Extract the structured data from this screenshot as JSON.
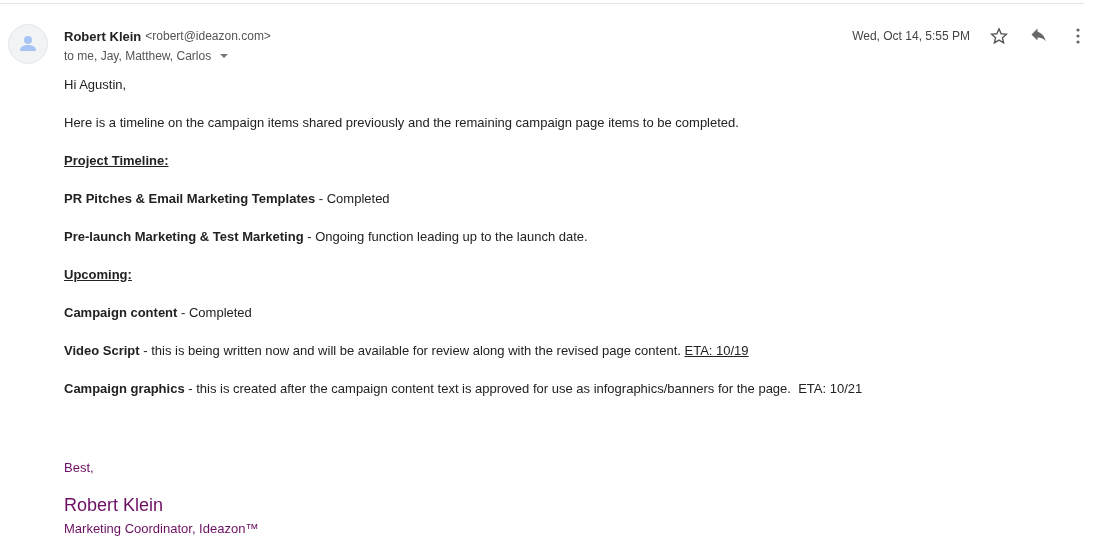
{
  "message": {
    "sender_name": "Robert Klein",
    "sender_email": "<robert@ideazon.com>",
    "recipients": "to me, Jay, Matthew, Carlos",
    "date": "Wed, Oct 14, 5:55 PM",
    "starred": false
  },
  "body": [
    {
      "kind": "text",
      "text": "Hi Agustin,"
    },
    {
      "kind": "text",
      "text": "Here is a timeline on the campaign items shared previously and the remaining campaign page items to be completed."
    },
    {
      "kind": "heading",
      "text": "Project Timeline:"
    },
    {
      "kind": "text",
      "text": "**PR Pitches & Email Marketing Templates** - Completed"
    },
    {
      "kind": "text",
      "text": "**Pre-launch Marketing & Test Marketing** - Ongoing function leading up to the launch date."
    },
    {
      "kind": "heading",
      "text": "Upcoming:"
    },
    {
      "kind": "text",
      "text": "**Campaign content** - Completed"
    },
    {
      "kind": "text",
      "text": "**Video Script** - this is being written now and will be available for review along with the revised page content.",
      "link": "ETA: 10/19"
    },
    {
      "kind": "text",
      "text": "**Campaign graphics** - this is created after the campaign content text is approved for use as infographics/banners for the page.  ETA: 10/21"
    }
  ],
  "signature": {
    "closing": "Best,",
    "name": "Robert Klein",
    "title": "Marketing Coordinator, Ideazon™"
  }
}
